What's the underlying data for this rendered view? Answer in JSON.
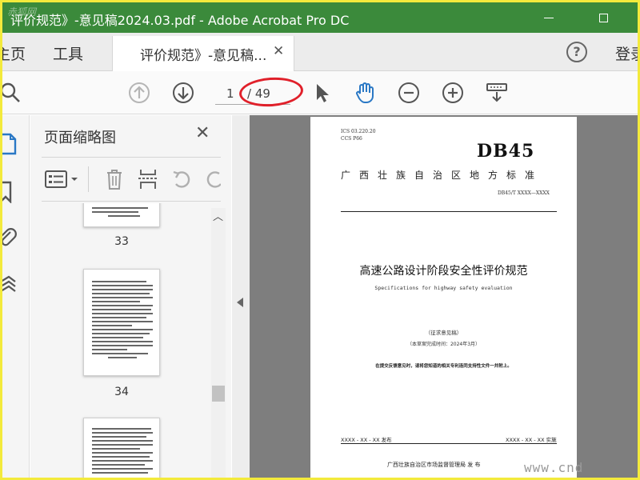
{
  "window": {
    "title": "评价规范》-意见稿2024.03.pdf - Adobe Acrobat Pro DC",
    "corner_watermark": "赤狐网"
  },
  "menu": {
    "home": "主页",
    "tools": "工具",
    "doc_tab": "评价规范》-意见稿...",
    "signin": "登录"
  },
  "toolbar": {
    "page_current": "1",
    "page_total": "/ 49",
    "highlight_color": "#e0202a"
  },
  "panel": {
    "title": "页面缩略图",
    "thumbnails": [
      {
        "number": "33"
      },
      {
        "number": "34"
      },
      {
        "number": ""
      }
    ]
  },
  "document": {
    "ics": "ICS  03.220.20",
    "ccs": "CCS P66",
    "db": "DB45",
    "standard_title": "广西壮族自治区地方标准",
    "code": "DB45/T XXXX—XXXX",
    "title": "高速公路设计阶段安全性评价规范",
    "subtitle": "Specifications for highway safety evaluation",
    "draft": "（征求意见稿）",
    "draft_date": "（本草案完成时间：2024年3月）",
    "note": "在提交反馈意见时，请将您知道的相关专利连同支持性文件一并附上。",
    "issue_date": "XXXX - XX - XX 发布",
    "impl_date": "XXXX - XX - XX 实施",
    "publisher": "广西壮族自治区市场监督管理局    发 布"
  },
  "page_watermark": "www.cnd"
}
